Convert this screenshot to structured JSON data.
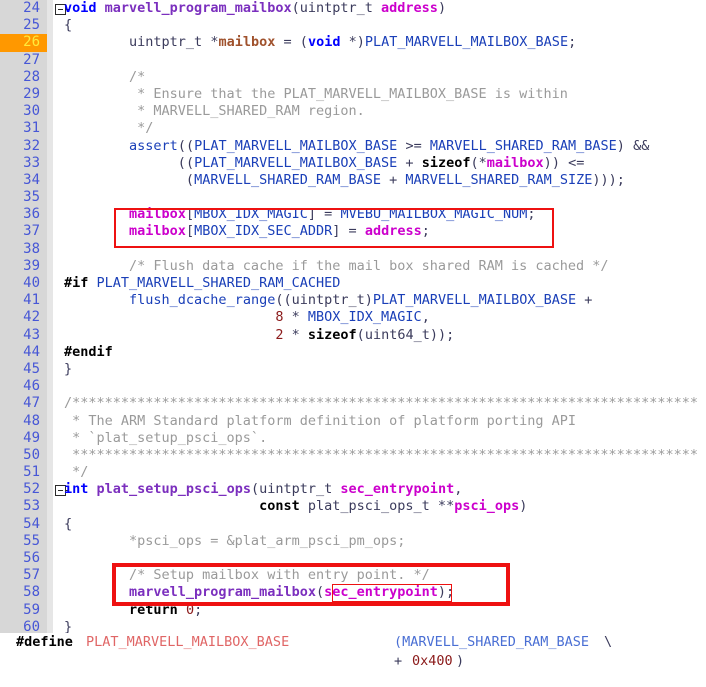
{
  "editor": {
    "kind": "source-code-editor",
    "language": "C",
    "current_line": 26,
    "gutter_bg": "#d7d7d7",
    "current_line_bg": "#ff9800",
    "current_line_fg": "#ffeb3b",
    "annotation_color": "#ee1111",
    "first_line": 24,
    "last_line": 60,
    "line_numbers": [
      24,
      25,
      26,
      27,
      28,
      29,
      30,
      31,
      32,
      33,
      34,
      35,
      36,
      37,
      38,
      39,
      40,
      41,
      42,
      43,
      44,
      45,
      46,
      47,
      48,
      49,
      50,
      51,
      52,
      53,
      54,
      55,
      56,
      57,
      58,
      59,
      60
    ],
    "lines": [
      {
        "n": 24,
        "fold": true,
        "text": "void marvell_program_mailbox(uintptr_t address)"
      },
      {
        "n": 25,
        "fold": false,
        "text": "{"
      },
      {
        "n": 26,
        "fold": false,
        "text": "        uintptr_t *mailbox = (void *)PLAT_MARVELL_MAILBOX_BASE;"
      },
      {
        "n": 27,
        "fold": false,
        "text": ""
      },
      {
        "n": 28,
        "fold": false,
        "text": "        /*"
      },
      {
        "n": 29,
        "fold": false,
        "text": "         * Ensure that the PLAT_MARVELL_MAILBOX_BASE is within"
      },
      {
        "n": 30,
        "fold": false,
        "text": "         * MARVELL_SHARED_RAM region."
      },
      {
        "n": 31,
        "fold": false,
        "text": "         */"
      },
      {
        "n": 32,
        "fold": false,
        "text": "        assert((PLAT_MARVELL_MAILBOX_BASE >= MARVELL_SHARED_RAM_BASE) &&"
      },
      {
        "n": 33,
        "fold": false,
        "text": "              ((PLAT_MARVELL_MAILBOX_BASE + sizeof(*mailbox)) <="
      },
      {
        "n": 34,
        "fold": false,
        "text": "               (MARVELL_SHARED_RAM_BASE + MARVELL_SHARED_RAM_SIZE)));"
      },
      {
        "n": 35,
        "fold": false,
        "text": ""
      },
      {
        "n": 36,
        "fold": false,
        "text": "        mailbox[MBOX_IDX_MAGIC] = MVEBU_MAILBOX_MAGIC_NUM;"
      },
      {
        "n": 37,
        "fold": false,
        "text": "        mailbox[MBOX_IDX_SEC_ADDR] = address;"
      },
      {
        "n": 38,
        "fold": false,
        "text": ""
      },
      {
        "n": 39,
        "fold": false,
        "text": "        /* Flush data cache if the mail box shared RAM is cached */"
      },
      {
        "n": 40,
        "fold": false,
        "text": "#if PLAT_MARVELL_SHARED_RAM_CACHED"
      },
      {
        "n": 41,
        "fold": false,
        "text": "        flush_dcache_range((uintptr_t)PLAT_MARVELL_MAILBOX_BASE +"
      },
      {
        "n": 42,
        "fold": false,
        "text": "                          8 * MBOX_IDX_MAGIC,"
      },
      {
        "n": 43,
        "fold": false,
        "text": "                          2 * sizeof(uint64_t));"
      },
      {
        "n": 44,
        "fold": false,
        "text": "#endif"
      },
      {
        "n": 45,
        "fold": false,
        "text": "}"
      },
      {
        "n": 46,
        "fold": false,
        "text": ""
      },
      {
        "n": 47,
        "fold": false,
        "text": "/*****************************************************************************"
      },
      {
        "n": 48,
        "fold": false,
        "text": " * The ARM Standard platform definition of platform porting API"
      },
      {
        "n": 49,
        "fold": false,
        "text": " * `plat_setup_psci_ops`."
      },
      {
        "n": 50,
        "fold": false,
        "text": " *****************************************************************************"
      },
      {
        "n": 51,
        "fold": false,
        "text": " */"
      },
      {
        "n": 52,
        "fold": true,
        "text": "int plat_setup_psci_ops(uintptr_t sec_entrypoint,"
      },
      {
        "n": 53,
        "fold": false,
        "text": "                        const plat_psci_ops_t **psci_ops)"
      },
      {
        "n": 54,
        "fold": false,
        "text": "{"
      },
      {
        "n": 55,
        "fold": false,
        "text": "        *psci_ops = &plat_arm_psci_pm_ops;"
      },
      {
        "n": 56,
        "fold": false,
        "text": ""
      },
      {
        "n": 57,
        "fold": false,
        "text": "        /* Setup mailbox with entry point. */"
      },
      {
        "n": 58,
        "fold": false,
        "text": "        marvell_program_mailbox(sec_entrypoint);"
      },
      {
        "n": 59,
        "fold": false,
        "text": "        return 0;"
      },
      {
        "n": 60,
        "fold": false,
        "text": "}"
      }
    ]
  },
  "annotations": [
    {
      "id": "mailbox-assign-box",
      "label": "red-box-around-mailbox-assignments",
      "lines": [
        36,
        37
      ]
    },
    {
      "id": "program-mailbox-box",
      "label": "red-box-around-mailbox-setup-call",
      "lines": [
        57,
        58
      ]
    },
    {
      "id": "sec-entrypoint-box",
      "label": "red-box-around-sec-entrypoint-arg",
      "lines": [
        58
      ]
    }
  ],
  "define_pane": {
    "lines": [
      {
        "directive": "#define",
        "name": "PLAT_MARVELL_MAILBOX_BASE",
        "value_left": "(MARVELL_SHARED_RAM_BASE",
        "continuation": "\\"
      },
      {
        "operator": "+",
        "number": "0x400",
        "close": ")"
      }
    ]
  }
}
